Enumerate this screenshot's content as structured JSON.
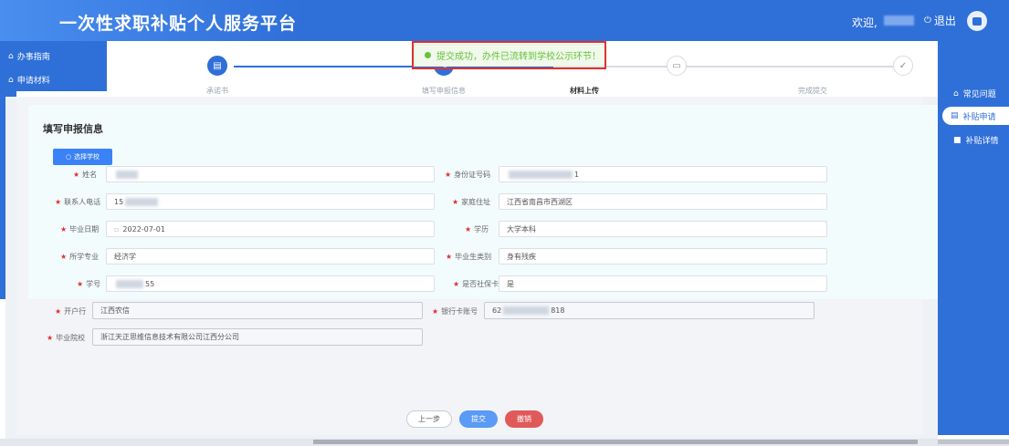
{
  "header": {
    "app_title": "一次性求职补贴个人服务平台",
    "welcome": "欢迎,",
    "logout": "退出",
    "colors": {
      "primary": "#2f6fd8",
      "danger": "#e05a5a",
      "success": "#67c23a"
    }
  },
  "left_nav": {
    "items": [
      {
        "label": "办事指南",
        "icon": "home-icon"
      },
      {
        "label": "申请材料",
        "icon": "home-icon"
      }
    ]
  },
  "right_nav": {
    "items": [
      {
        "label": "常见问题",
        "icon": "home-icon"
      },
      {
        "label": "补贴申请",
        "icon": "list-icon"
      },
      {
        "label": "补贴详情",
        "icon": "square-icon"
      }
    ],
    "active": "补贴申请"
  },
  "steps": {
    "items": [
      {
        "label": "承诺书",
        "icon": "clipboard-icon"
      },
      {
        "label": "填写申报信息",
        "icon": "edit-icon"
      },
      {
        "label": "材料上传",
        "icon": "inbox-icon"
      },
      {
        "label": "完成提交",
        "icon": "check-icon"
      }
    ],
    "current": "材料上传"
  },
  "toast": {
    "message": "提交成功，办件已流转到学校公示环节！"
  },
  "form": {
    "section_title": "填写申报信息",
    "choose_school": "选择学校",
    "fields": {
      "name": {
        "label": "姓名",
        "value": ""
      },
      "id_number": {
        "label": "身份证号码",
        "value": "1"
      },
      "contact_phone": {
        "label": "联系人电话",
        "value": "15"
      },
      "home_address": {
        "label": "家庭住址",
        "value": "江西省南昌市西湖区"
      },
      "graduation_date": {
        "label": "毕业日期",
        "value": "2022-07-01"
      },
      "education": {
        "label": "学历",
        "value": "大学本科"
      },
      "major": {
        "label": "所学专业",
        "value": "经济学"
      },
      "graduate_category": {
        "label": "毕业生类别",
        "value": "身有残疾"
      },
      "student_id": {
        "label": "学号",
        "value": "55"
      },
      "social_security_card": {
        "label": "是否社保卡",
        "value": "是"
      },
      "bank": {
        "label": "开户行",
        "value": "江西农信"
      },
      "bank_card": {
        "label": "银行卡账号",
        "value_prefix": "62",
        "value_suffix": "818"
      },
      "school": {
        "label": "毕业院校",
        "value": "浙江天正思维信息技术有限公司江西分公司"
      }
    }
  },
  "actions": {
    "prev": "上一步",
    "submit": "提交",
    "cancel": "撤销"
  }
}
